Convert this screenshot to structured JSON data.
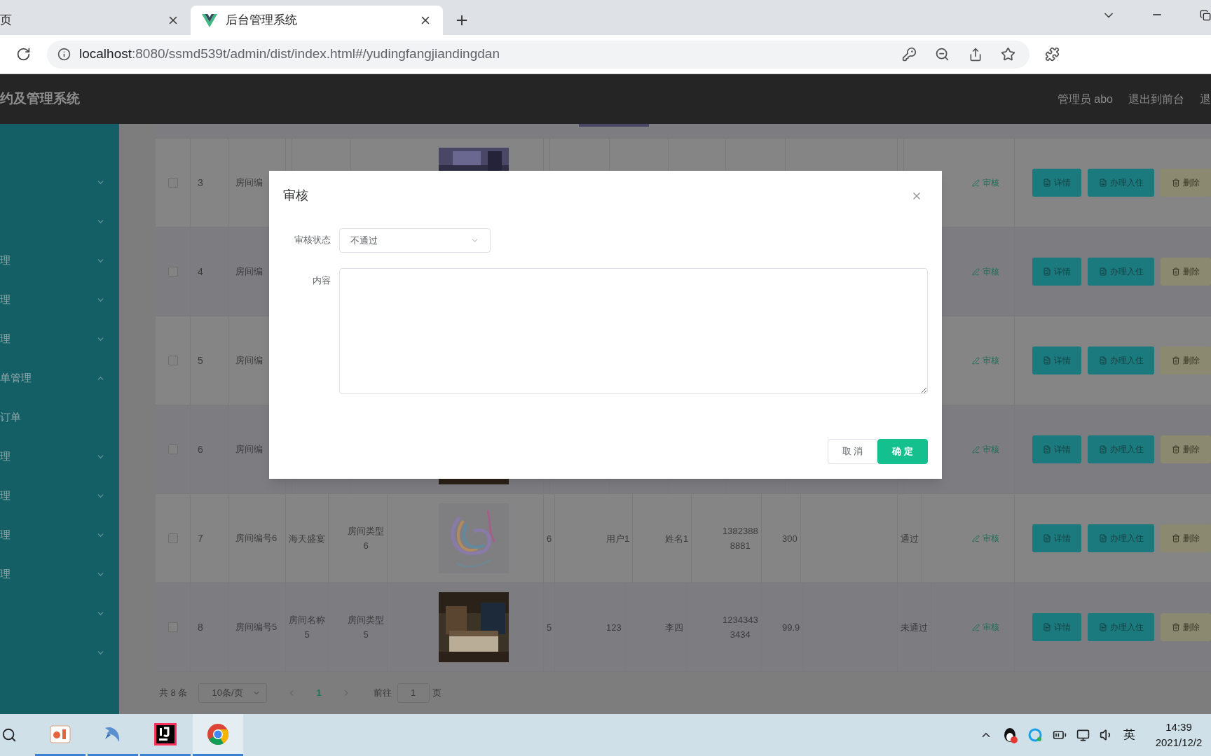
{
  "browser": {
    "tabs": [
      {
        "title": "页",
        "selected": false
      },
      {
        "title": "后台管理系统",
        "selected": true
      }
    ],
    "url_host": "localhost",
    "url_path": ":8080/ssmd539t/admin/dist/index.html#/yudingfangjiandingdan"
  },
  "header": {
    "title": "约及管理系统",
    "links": [
      "管理员 abo",
      "退出到前台",
      "退"
    ]
  },
  "sidebar": {
    "items": [
      {
        "kind": "menu",
        "expanded": false
      },
      {
        "kind": "menu",
        "expanded": false
      },
      {
        "kind": "menu",
        "label": "理",
        "expanded": false
      },
      {
        "kind": "menu",
        "label": "理",
        "expanded": false
      },
      {
        "kind": "menu",
        "label": "理",
        "expanded": false
      },
      {
        "kind": "menu",
        "label": "单管理",
        "expanded": true
      },
      {
        "kind": "sub",
        "label": "订单"
      },
      {
        "kind": "menu",
        "label": "理",
        "expanded": false
      },
      {
        "kind": "menu",
        "label": "理",
        "expanded": false
      },
      {
        "kind": "menu",
        "label": "理",
        "expanded": false
      },
      {
        "kind": "menu",
        "label": "理",
        "expanded": false
      },
      {
        "kind": "menu",
        "expanded": false
      },
      {
        "kind": "menu",
        "expanded": false
      }
    ]
  },
  "table": {
    "top_picture": {
      "kind": "picture"
    },
    "rows": [
      {
        "checked": false,
        "column_1": "3",
        "column_2": "房间编",
        "column_5": {
          "kind": "picture"
        },
        "column_13": "审核",
        "actions": [
          {
            "label": "详情",
            "kind": "detail"
          },
          {
            "label": "办理入住",
            "kind": "checkin"
          },
          {
            "label": "删除",
            "kind": "delete"
          }
        ]
      },
      {
        "checked": false,
        "column_1": "4",
        "column_2": "房间编",
        "column_13": "审核",
        "actions": [
          {
            "label": "详情",
            "kind": "detail"
          },
          {
            "label": "办理入住",
            "kind": "checkin"
          },
          {
            "label": "删除",
            "kind": "delete"
          }
        ]
      },
      {
        "checked": false,
        "column_1": "5",
        "column_2": "房间编",
        "column_13": "审核",
        "actions": [
          {
            "label": "详情",
            "kind": "detail"
          },
          {
            "label": "办理入住",
            "kind": "checkin"
          },
          {
            "label": "删除",
            "kind": "delete"
          }
        ]
      },
      {
        "checked": false,
        "column_1": "6",
        "column_2": "房间编",
        "column_5": {
          "kind": "picture"
        },
        "column_13": "审核",
        "actions": [
          {
            "label": "详情",
            "kind": "detail"
          },
          {
            "label": "办理入住",
            "kind": "checkin"
          },
          {
            "label": "删除",
            "kind": "delete"
          }
        ]
      },
      {
        "checked": false,
        "column_1": "7",
        "column_2": "房间编号6",
        "column_3": "海天盛宴",
        "column_4": "房间类型6",
        "column_5": {
          "kind": "picture"
        },
        "column_6": "6",
        "column_7": "用户1",
        "column_8": "姓名1",
        "column_9": "13823888881",
        "column_10": "300",
        "column_12": "通过",
        "column_13": "审核",
        "actions": [
          {
            "label": "详情",
            "kind": "detail"
          },
          {
            "label": "办理入住",
            "kind": "checkin"
          },
          {
            "label": "删除",
            "kind": "delete"
          }
        ]
      },
      {
        "checked": false,
        "column_1": "8",
        "column_2": "房间编号5",
        "column_3": "房间名称5",
        "column_4": "房间类型5",
        "column_5": {
          "kind": "picture"
        },
        "column_6": "5",
        "column_7": "123",
        "column_8": "李四",
        "column_9": "12343433434",
        "column_10": "99.9",
        "column_12": "未通过",
        "column_13": "审核",
        "actions": [
          {
            "label": "详情",
            "kind": "detail"
          },
          {
            "label": "办理入住",
            "kind": "checkin"
          },
          {
            "label": "删除",
            "kind": "delete"
          }
        ]
      }
    ]
  },
  "pagination": {
    "total": "共 8 条",
    "page_size": "10条/页",
    "pages": [
      {
        "label": "1",
        "selected": true
      }
    ],
    "goto_label": "前往",
    "goto_value": "1",
    "goto_suffix": "页"
  },
  "dialog": {
    "title": "审核",
    "fields": [
      {
        "label": "审核状态",
        "kind": "select",
        "value": "不通过"
      },
      {
        "label": "内容",
        "kind": "textarea"
      }
    ],
    "buttons": [
      {
        "label": "取 消",
        "kind": "cancel"
      },
      {
        "label": "确 定",
        "kind": "primary"
      }
    ]
  },
  "taskbar": {
    "apps": [
      {
        "kind": "slides",
        "selected": false
      },
      {
        "kind": "dolphin",
        "selected": false
      },
      {
        "kind": "ide",
        "selected": false
      },
      {
        "kind": "browser",
        "selected": true
      }
    ],
    "ime": "英",
    "time": "14:39",
    "date": "2021/12/2"
  }
}
